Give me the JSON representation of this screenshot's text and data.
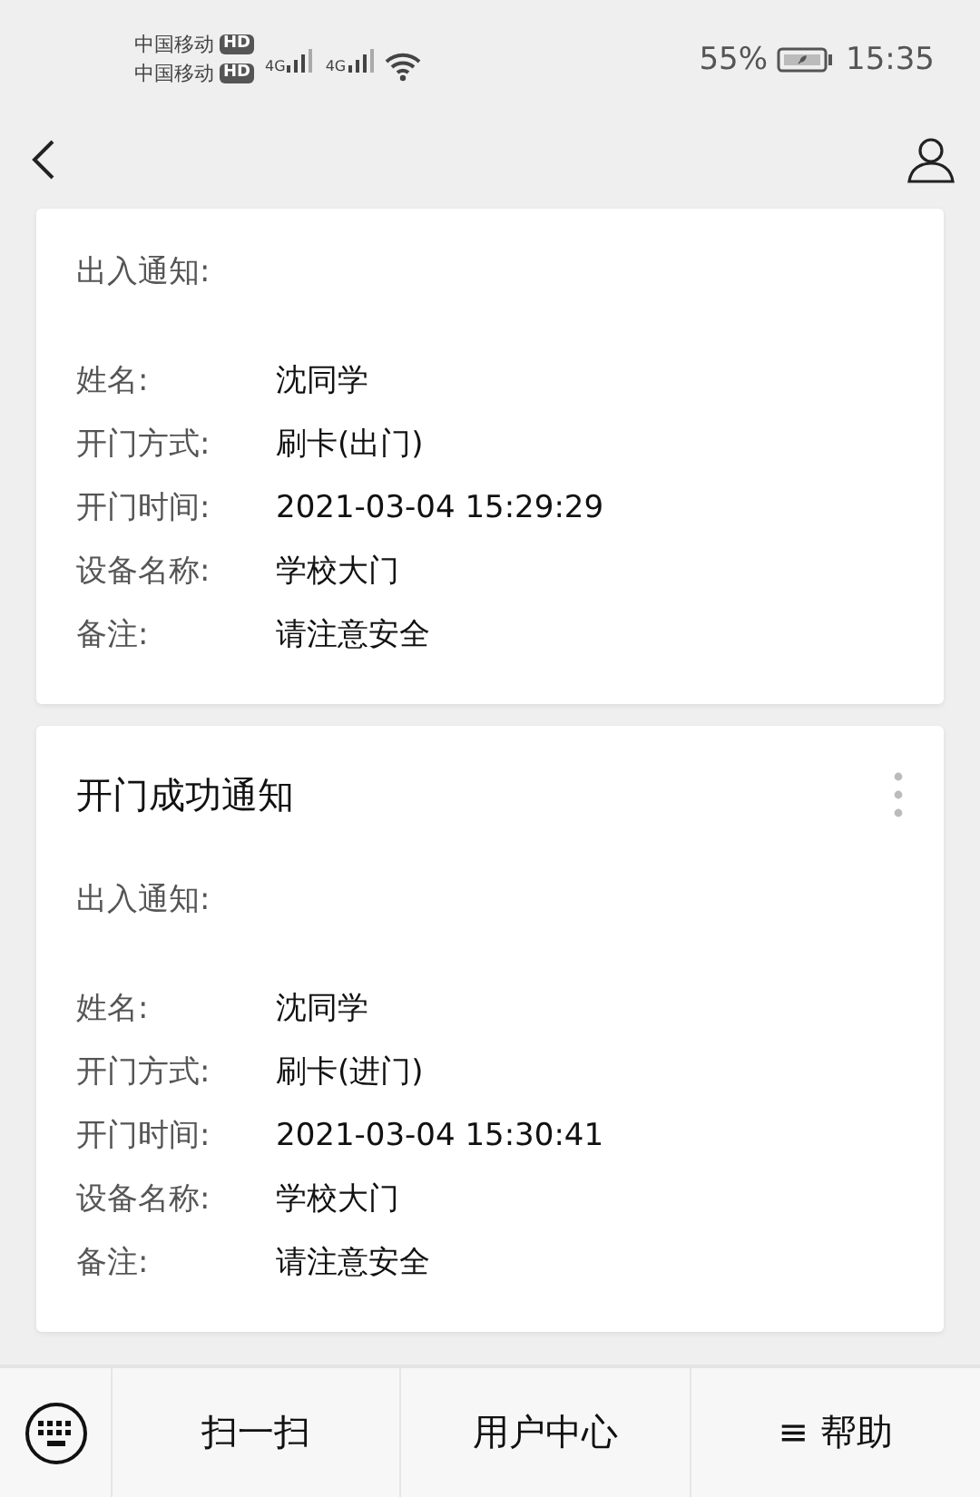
{
  "status_bar": {
    "carriers": [
      {
        "name": "中国移动",
        "badge": "HD"
      },
      {
        "name": "中国移动",
        "badge": "HD"
      }
    ],
    "networks": [
      "4G",
      "4G"
    ],
    "battery": "55%",
    "time": "15:35"
  },
  "cards": [
    {
      "heading": "出入通知:",
      "fields": [
        {
          "label": "姓名:",
          "value": "沈同学"
        },
        {
          "label": "开门方式:",
          "value": "刷卡(出门)"
        },
        {
          "label": "开门时间:",
          "value": "2021-03-04 15:29:29"
        },
        {
          "label": "设备名称:",
          "value": "学校大门"
        },
        {
          "label": "备注:",
          "value": "请注意安全"
        }
      ]
    },
    {
      "title": "开门成功通知",
      "heading": "出入通知:",
      "fields": [
        {
          "label": "姓名:",
          "value": "沈同学"
        },
        {
          "label": "开门方式:",
          "value": "刷卡(进门)"
        },
        {
          "label": "开门时间:",
          "value": "2021-03-04 15:30:41"
        },
        {
          "label": "设备名称:",
          "value": "学校大门"
        },
        {
          "label": "备注:",
          "value": "请注意安全"
        }
      ]
    }
  ],
  "bottom_menu": [
    "扫一扫",
    "用户中心",
    "≡ 帮助"
  ]
}
